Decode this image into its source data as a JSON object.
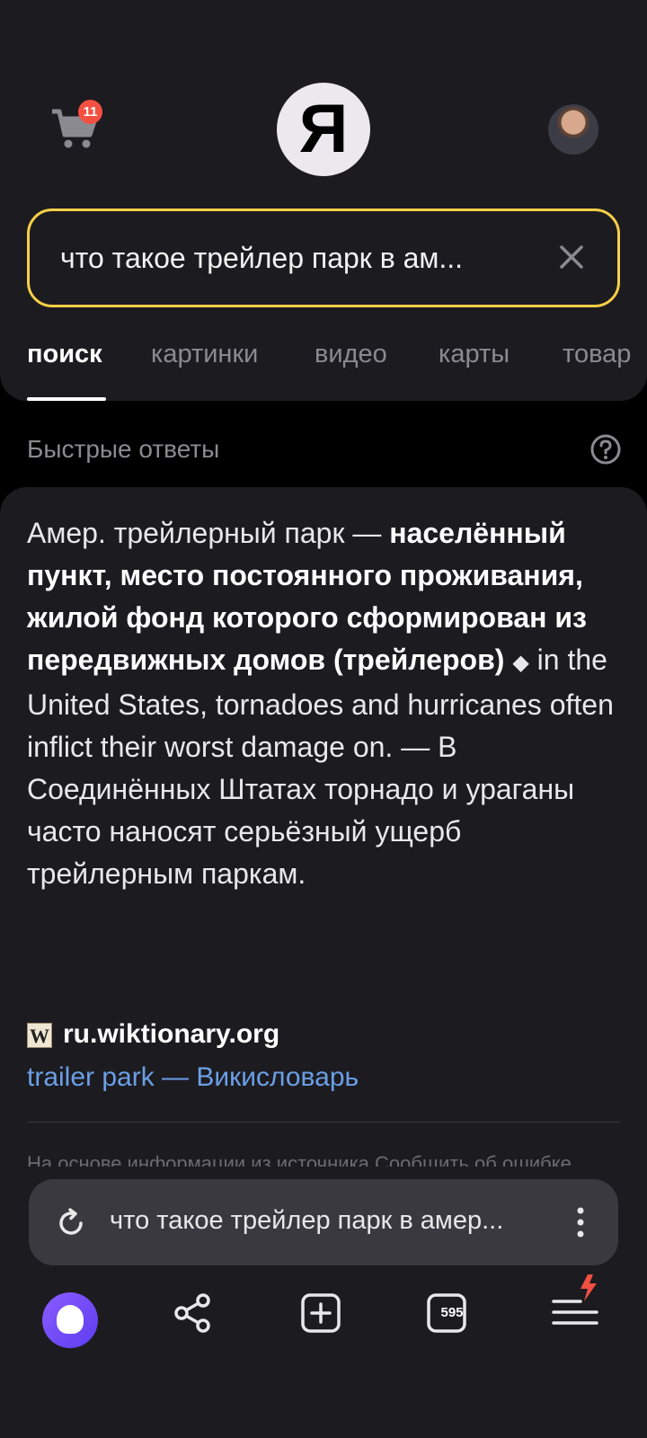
{
  "header": {
    "cart_badge": "11",
    "logo_letter": "Я",
    "search_query": "что такое трейлер парк в ам...",
    "tabs": [
      {
        "label": "поиск",
        "active": true
      },
      {
        "label": "картинки"
      },
      {
        "label": "видео"
      },
      {
        "label": "карты"
      },
      {
        "label": "товар"
      }
    ]
  },
  "quick_answers": {
    "title": "Быстрые ответы",
    "answer_lead": "Амер. трейлерный парк — ",
    "answer_bold": "населённый пункт, место постоянного проживания, жилой фонд которого сформирован из передвижных домов (трейлеров)",
    "answer_rest": " in the United States, tornadoes and hurricanes often inflict their worst damage on. — В Соединённых Штатах торнадо и ураганы часто наносят серьёзный ущерб трейлерным паркам.",
    "source_icon_letter": "W",
    "source_domain": "ru.wiktionary.org",
    "source_link": "trailer park — Викисловарь",
    "footnote": "На основе информации из источника      Сообщить об ошибке"
  },
  "browser": {
    "address_text": "что такое трейлер парк в амер...",
    "tabs_count": "595",
    "accent_color": "#f7cf46",
    "link_color": "#6b9fe6",
    "badge_color": "#f45042"
  }
}
